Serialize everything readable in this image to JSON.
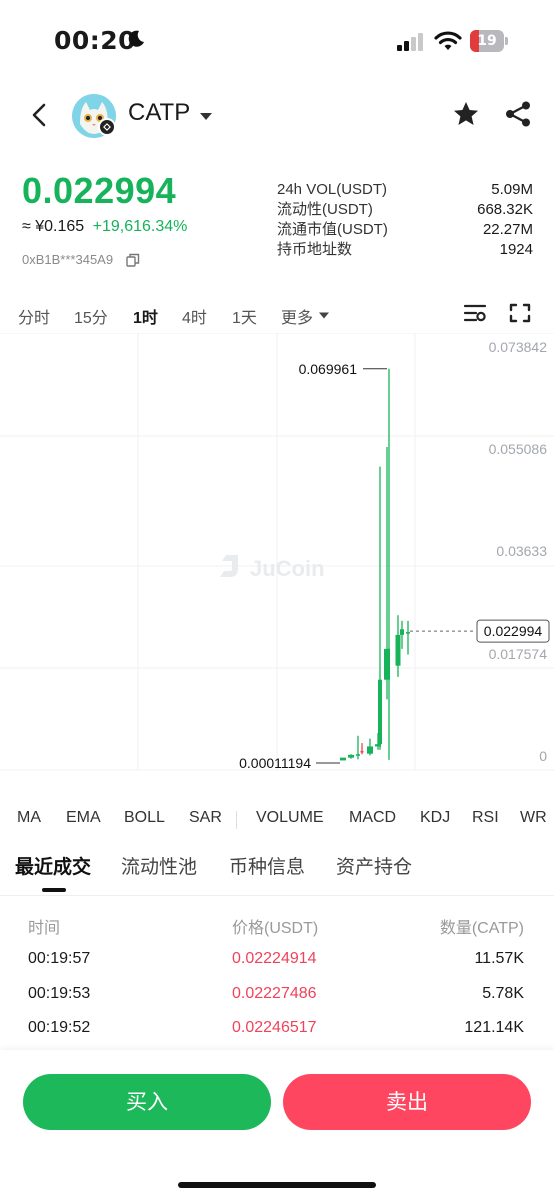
{
  "status_bar": {
    "time": "00:20",
    "battery": "19"
  },
  "header": {
    "token": "CATP"
  },
  "price": {
    "last": "0.022994",
    "approx_prefix": "≈ ¥",
    "approx_value": "0.165",
    "change_pct": "+19,616.34%",
    "address": "0xB1B***345A9"
  },
  "stats": [
    {
      "label": "24h VOL(USDT)",
      "value": "5.09M"
    },
    {
      "label": "流动性(USDT)",
      "value": "668.32K"
    },
    {
      "label": "流通市值(USDT)",
      "value": "22.27M"
    },
    {
      "label": "持币地址数",
      "value": "1924"
    }
  ],
  "time_tabs": [
    "分时",
    "15分",
    "1时",
    "4时",
    "1天",
    "更多"
  ],
  "time_tab_active": "1时",
  "chart_data": {
    "type": "candlestick",
    "y_axis_labels": [
      "0.073842",
      "0.055086",
      "0.03633",
      "0.017574",
      "0"
    ],
    "ylim": [
      0,
      0.073842
    ],
    "high_label": "0.069961",
    "low_label": "0.00011194",
    "current_price_label": "0.022994",
    "watermark": "JuCoin",
    "candles": [
      {
        "open": 0.0001,
        "high": 0.0006,
        "low": 0.0001,
        "close": 0.0006,
        "dir": "up"
      },
      {
        "open": 0.0006,
        "high": 0.0012,
        "low": 0.0004,
        "close": 0.0011,
        "dir": "up"
      },
      {
        "open": 0.0011,
        "high": 0.0045,
        "low": 0.0003,
        "close": 0.0012,
        "dir": "up"
      },
      {
        "open": 0.0018,
        "high": 0.0032,
        "low": 0.0012,
        "close": 0.0015,
        "dir": "down"
      },
      {
        "open": 0.0013,
        "high": 0.004,
        "low": 0.001,
        "close": 0.0026,
        "dir": "up"
      },
      {
        "open": 0.0026,
        "high": 0.005,
        "low": 0.002,
        "close": 0.003,
        "dir": "up"
      },
      {
        "open": 0.003,
        "high": 0.0525,
        "low": 0.002,
        "close": 0.0145,
        "dir": "up"
      },
      {
        "open": 0.0145,
        "high": 0.056,
        "low": 0.011,
        "close": 0.02,
        "dir": "up"
      },
      {
        "open": 0.02,
        "high": 0.069961,
        "low": 0.0002,
        "close": 0.0195,
        "dir": "up"
      },
      {
        "open": 0.017,
        "high": 0.026,
        "low": 0.015,
        "close": 0.0225,
        "dir": "up"
      },
      {
        "open": 0.0225,
        "high": 0.025,
        "low": 0.02,
        "close": 0.0235,
        "dir": "up"
      },
      {
        "open": 0.0228,
        "high": 0.025,
        "low": 0.019,
        "close": 0.02299,
        "dir": "up"
      }
    ]
  },
  "indicators": [
    "MA",
    "EMA",
    "BOLL",
    "SAR",
    "VOLUME",
    "MACD",
    "KDJ",
    "RSI",
    "WR"
  ],
  "section_tabs": [
    "最近成交",
    "流动性池",
    "币种信息",
    "资产持仓"
  ],
  "section_tab_active": "最近成交",
  "trades": {
    "headers": [
      "时间",
      "价格(USDT)",
      "数量(CATP)"
    ],
    "rows": [
      {
        "time": "00:19:57",
        "price": "0.02224914",
        "qty": "11.57K"
      },
      {
        "time": "00:19:53",
        "price": "0.02227486",
        "qty": "5.78K"
      },
      {
        "time": "00:19:52",
        "price": "0.02246517",
        "qty": "121.14K"
      }
    ]
  },
  "buttons": {
    "buy": "买入",
    "sell": "卖出"
  },
  "colors": {
    "up": "#16b35b",
    "down": "#f0435a",
    "buy": "#1cb85a",
    "sell": "#ff4660"
  }
}
